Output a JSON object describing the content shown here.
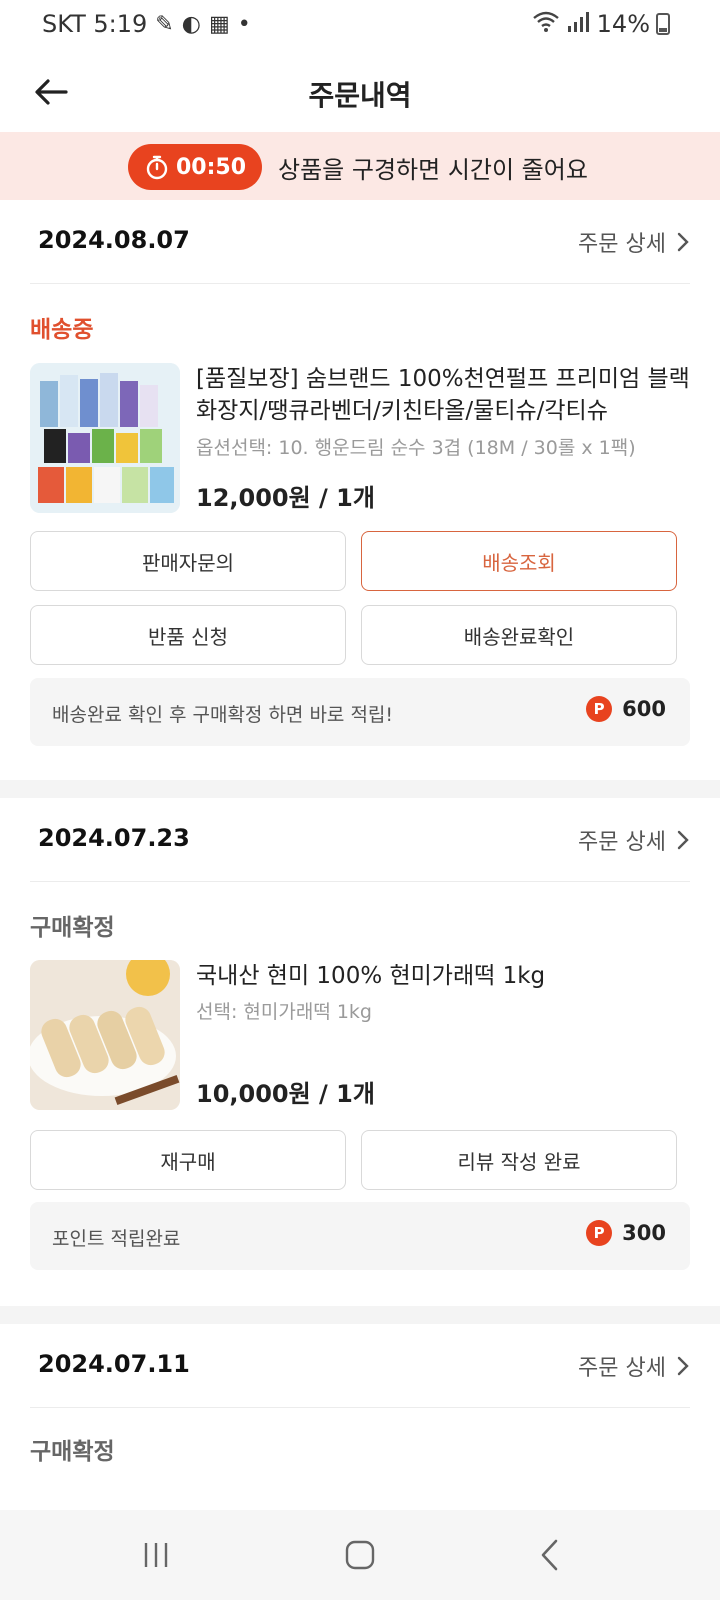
{
  "status_bar": {
    "carrier_time": "SKT 5:19",
    "battery": "14%"
  },
  "header": {
    "title": "주문내역"
  },
  "banner": {
    "timer": "00:50",
    "message": "상품을 구경하면 시간이 줄어요"
  },
  "orders": [
    {
      "date": "2024.08.07",
      "detail_label": "주문 상세",
      "status": "배송중",
      "product_name": "[품질보장] 숨브랜드 100%천연펄프 프리미엄 블랙화장지/땡큐라벤더/키친타올/물티슈/각티슈",
      "option": "옵션선택: 10. 행운드림 순수 3겹 (18M / 30롤 x 1팩)",
      "price": "12,000원 / 1개",
      "buttons": [
        "판매자문의",
        "배송조회",
        "반품 신청",
        "배송완료확인"
      ],
      "point_text": "배송완료 확인 후 구매확정 하면 바로 적립!",
      "point_value": "600"
    },
    {
      "date": "2024.07.23",
      "detail_label": "주문 상세",
      "status": "구매확정",
      "product_name": "국내산 현미 100% 현미가래떡 1kg",
      "option": "선택: 현미가래떡 1kg",
      "price": "10,000원 / 1개",
      "buttons": [
        "재구매",
        "리뷰 작성 완료"
      ],
      "point_text": "포인트 적립완료",
      "point_value": "300"
    },
    {
      "date": "2024.07.11",
      "detail_label": "주문 상세",
      "status": "구매확정"
    }
  ],
  "point_badge": "P",
  "colors": {
    "accent": "#e8431f",
    "banner_bg": "#fce8e4",
    "status_active": "#e0502e"
  }
}
